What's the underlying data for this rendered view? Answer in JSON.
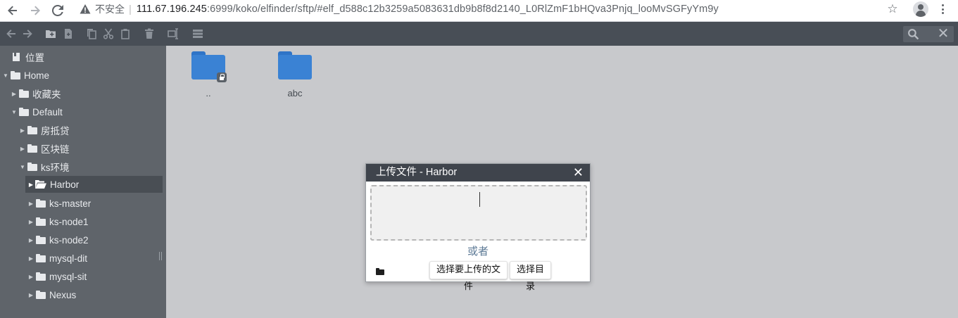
{
  "browser": {
    "insecure_label": "不安全",
    "url_host": "111.67.196.245",
    "url_rest": ":6999/koko/elfinder/sftp/#elf_d588c12b3259a5083631db9b8f8d2140_L0RlZmF1bHQva3Pnjq_looMvSGFyYm9y"
  },
  "toolbar": {
    "icons": [
      "back-icon",
      "forward-icon",
      "new-folder-icon",
      "new-file-icon",
      "copy-icon",
      "cut-icon",
      "paste-icon",
      "delete-icon",
      "rename-icon",
      "view-icon"
    ],
    "search_icon": "search-icon",
    "close_icon": "close-icon"
  },
  "sidebar": {
    "places_label": "位置",
    "tree": [
      {
        "label": "Home"
      },
      {
        "label": "收藏夹"
      },
      {
        "label": "Default"
      },
      {
        "label": "房抵贷"
      },
      {
        "label": "区块链"
      },
      {
        "label": "ks环境"
      },
      {
        "label": "Harbor"
      },
      {
        "label": "ks-master"
      },
      {
        "label": "ks-node1"
      },
      {
        "label": "ks-node2"
      },
      {
        "label": "mysql-dit"
      },
      {
        "label": "mysql-sit"
      },
      {
        "label": "Nexus"
      }
    ]
  },
  "main": {
    "files": [
      {
        "name": ".."
      },
      {
        "name": "abc"
      }
    ]
  },
  "dialog": {
    "title": "上传文件 - Harbor",
    "close_glyph": "✕",
    "or_text": "或者",
    "select_files_label": "选择要上传的文件",
    "select_dir_label": "选择目录"
  },
  "colors": {
    "toolbar_bg": "#484e56",
    "sidebar_bg": "#5f646a",
    "main_bg": "#c8c9cc",
    "folder_blue": "#3a82d4",
    "dialog_title_bg": "#3f444c"
  }
}
